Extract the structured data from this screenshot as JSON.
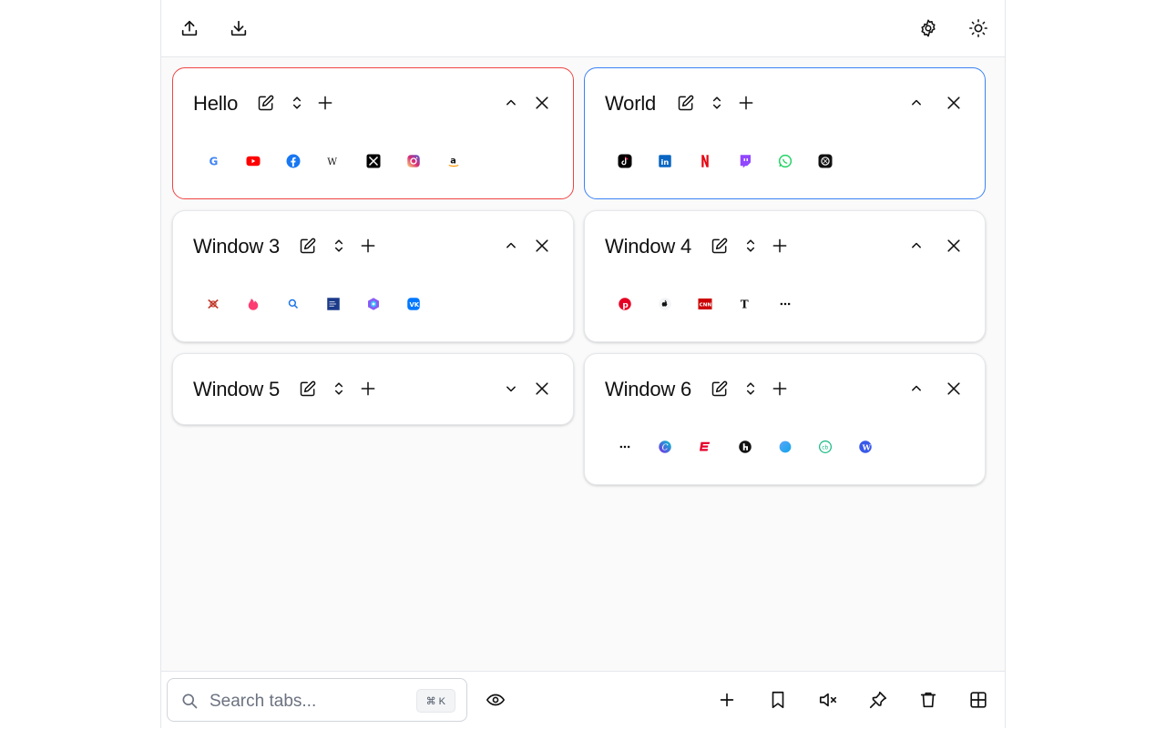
{
  "toolbar": {
    "upload_icon": "upload-icon",
    "download_icon": "download-icon",
    "settings_icon": "gear-icon",
    "theme_icon": "sun-icon"
  },
  "windows": [
    {
      "title": "Hello",
      "highlight": "#ef4444",
      "collapsed": false,
      "tabs": [
        "google",
        "youtube",
        "facebook",
        "wikipedia",
        "x",
        "instagram",
        "amazon"
      ]
    },
    {
      "title": "World",
      "highlight": "#3b82f6",
      "collapsed": false,
      "tabs": [
        "tiktok",
        "linkedin",
        "netflix",
        "twitch",
        "whatsapp",
        "openai"
      ]
    },
    {
      "title": "Window 3",
      "highlight": "",
      "collapsed": false,
      "tabs": [
        "red-logo",
        "tinder",
        "search",
        "weather-channel",
        "copilot",
        "vk"
      ]
    },
    {
      "title": "Window 4",
      "highlight": "",
      "collapsed": false,
      "tabs": [
        "pinterest",
        "apple",
        "cnn",
        "nytimes",
        "dots"
      ]
    },
    {
      "title": "Window 5",
      "highlight": "",
      "collapsed": true,
      "tabs": []
    },
    {
      "title": "Window 6",
      "highlight": "",
      "collapsed": false,
      "tabs": [
        "dots",
        "canva",
        "espn",
        "houzz",
        "blue-circle",
        "cb",
        "wordpress"
      ]
    }
  ],
  "search": {
    "placeholder": "Search tabs...",
    "shortcut": "⌘ K"
  },
  "bottom_actions": [
    "eye-icon",
    "plus-icon",
    "bookmark-icon",
    "mute-icon",
    "pin-icon",
    "trash-icon",
    "grid-icon"
  ]
}
